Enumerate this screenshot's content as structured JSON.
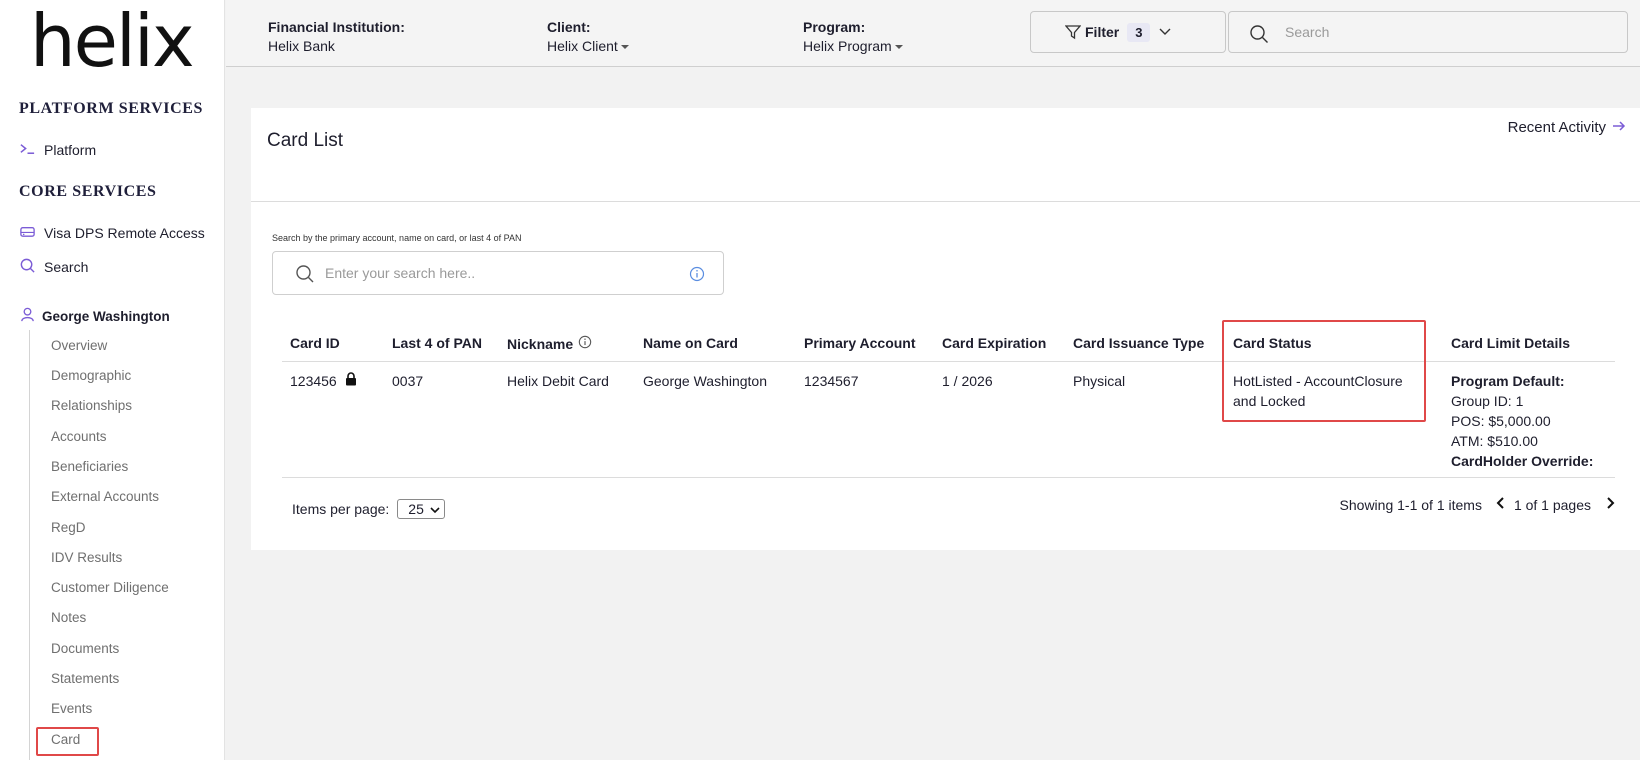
{
  "logo": "helix",
  "sidebar": {
    "platform_title": "PLATFORM SERVICES",
    "platform_item": "Platform",
    "core_title": "CORE SERVICES",
    "core_items": [
      "Visa DPS Remote Access",
      "Search"
    ],
    "customer_name": "George Washington",
    "sub_items": [
      "Overview",
      "Demographic",
      "Relationships",
      "Accounts",
      "Beneficiaries",
      "External Accounts",
      "RegD",
      "IDV Results",
      "Customer Diligence",
      "Notes",
      "Documents",
      "Statements",
      "Events",
      "Card"
    ]
  },
  "topbar": {
    "fi_label": "Financial Institution:",
    "fi_value": "Helix Bank",
    "client_label": "Client:",
    "client_value": "Helix Client",
    "program_label": "Program:",
    "program_value": "Helix Program",
    "filter_label": "Filter",
    "filter_count": "3",
    "search_placeholder": "Search"
  },
  "card_list": {
    "title": "Card List",
    "recent_activity": "Recent Activity",
    "search_hint": "Search by the primary account, name on card, or last 4 of PAN",
    "search_placeholder": "Enter your search here..",
    "columns": [
      "Card ID",
      "Last 4 of PAN",
      "Nickname",
      "Name on Card",
      "Primary Account",
      "Card Expiration",
      "Card Issuance Type",
      "Card Status",
      "Card Limit Details"
    ],
    "row": {
      "card_id": "123456",
      "last4": "0037",
      "nickname": "Helix Debit Card",
      "name_on_card": "George Washington",
      "primary_account": "1234567",
      "expiration": "1 / 2026",
      "issuance_type": "Physical",
      "status_line1": "HotListed - AccountClosure",
      "status_line2": "and Locked",
      "limit_program_default": "Program Default:",
      "limit_group": "Group ID: 1",
      "limit_pos": "POS: $5,000.00",
      "limit_atm": "ATM: $510.00",
      "limit_override": "CardHolder Override:"
    },
    "items_per_page_label": "Items per page:",
    "items_per_page_value": "25",
    "showing": "Showing 1-1 of 1 items",
    "pages": "1 of 1 pages"
  },
  "colors": {
    "accent": "#7b5cd6",
    "highlight": "#e04848"
  }
}
